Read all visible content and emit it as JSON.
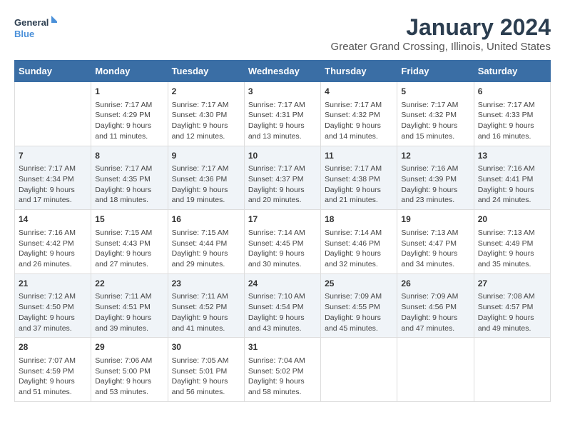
{
  "logo": {
    "line1": "General",
    "line2": "Blue"
  },
  "title": "January 2024",
  "subtitle": "Greater Grand Crossing, Illinois, United States",
  "days_of_week": [
    "Sunday",
    "Monday",
    "Tuesday",
    "Wednesday",
    "Thursday",
    "Friday",
    "Saturday"
  ],
  "weeks": [
    [
      {
        "day": "",
        "content": ""
      },
      {
        "day": "1",
        "content": "Sunrise: 7:17 AM\nSunset: 4:29 PM\nDaylight: 9 hours\nand 11 minutes."
      },
      {
        "day": "2",
        "content": "Sunrise: 7:17 AM\nSunset: 4:30 PM\nDaylight: 9 hours\nand 12 minutes."
      },
      {
        "day": "3",
        "content": "Sunrise: 7:17 AM\nSunset: 4:31 PM\nDaylight: 9 hours\nand 13 minutes."
      },
      {
        "day": "4",
        "content": "Sunrise: 7:17 AM\nSunset: 4:32 PM\nDaylight: 9 hours\nand 14 minutes."
      },
      {
        "day": "5",
        "content": "Sunrise: 7:17 AM\nSunset: 4:32 PM\nDaylight: 9 hours\nand 15 minutes."
      },
      {
        "day": "6",
        "content": "Sunrise: 7:17 AM\nSunset: 4:33 PM\nDaylight: 9 hours\nand 16 minutes."
      }
    ],
    [
      {
        "day": "7",
        "content": "Sunrise: 7:17 AM\nSunset: 4:34 PM\nDaylight: 9 hours\nand 17 minutes."
      },
      {
        "day": "8",
        "content": "Sunrise: 7:17 AM\nSunset: 4:35 PM\nDaylight: 9 hours\nand 18 minutes."
      },
      {
        "day": "9",
        "content": "Sunrise: 7:17 AM\nSunset: 4:36 PM\nDaylight: 9 hours\nand 19 minutes."
      },
      {
        "day": "10",
        "content": "Sunrise: 7:17 AM\nSunset: 4:37 PM\nDaylight: 9 hours\nand 20 minutes."
      },
      {
        "day": "11",
        "content": "Sunrise: 7:17 AM\nSunset: 4:38 PM\nDaylight: 9 hours\nand 21 minutes."
      },
      {
        "day": "12",
        "content": "Sunrise: 7:16 AM\nSunset: 4:39 PM\nDaylight: 9 hours\nand 23 minutes."
      },
      {
        "day": "13",
        "content": "Sunrise: 7:16 AM\nSunset: 4:41 PM\nDaylight: 9 hours\nand 24 minutes."
      }
    ],
    [
      {
        "day": "14",
        "content": "Sunrise: 7:16 AM\nSunset: 4:42 PM\nDaylight: 9 hours\nand 26 minutes."
      },
      {
        "day": "15",
        "content": "Sunrise: 7:15 AM\nSunset: 4:43 PM\nDaylight: 9 hours\nand 27 minutes."
      },
      {
        "day": "16",
        "content": "Sunrise: 7:15 AM\nSunset: 4:44 PM\nDaylight: 9 hours\nand 29 minutes."
      },
      {
        "day": "17",
        "content": "Sunrise: 7:14 AM\nSunset: 4:45 PM\nDaylight: 9 hours\nand 30 minutes."
      },
      {
        "day": "18",
        "content": "Sunrise: 7:14 AM\nSunset: 4:46 PM\nDaylight: 9 hours\nand 32 minutes."
      },
      {
        "day": "19",
        "content": "Sunrise: 7:13 AM\nSunset: 4:47 PM\nDaylight: 9 hours\nand 34 minutes."
      },
      {
        "day": "20",
        "content": "Sunrise: 7:13 AM\nSunset: 4:49 PM\nDaylight: 9 hours\nand 35 minutes."
      }
    ],
    [
      {
        "day": "21",
        "content": "Sunrise: 7:12 AM\nSunset: 4:50 PM\nDaylight: 9 hours\nand 37 minutes."
      },
      {
        "day": "22",
        "content": "Sunrise: 7:11 AM\nSunset: 4:51 PM\nDaylight: 9 hours\nand 39 minutes."
      },
      {
        "day": "23",
        "content": "Sunrise: 7:11 AM\nSunset: 4:52 PM\nDaylight: 9 hours\nand 41 minutes."
      },
      {
        "day": "24",
        "content": "Sunrise: 7:10 AM\nSunset: 4:54 PM\nDaylight: 9 hours\nand 43 minutes."
      },
      {
        "day": "25",
        "content": "Sunrise: 7:09 AM\nSunset: 4:55 PM\nDaylight: 9 hours\nand 45 minutes."
      },
      {
        "day": "26",
        "content": "Sunrise: 7:09 AM\nSunset: 4:56 PM\nDaylight: 9 hours\nand 47 minutes."
      },
      {
        "day": "27",
        "content": "Sunrise: 7:08 AM\nSunset: 4:57 PM\nDaylight: 9 hours\nand 49 minutes."
      }
    ],
    [
      {
        "day": "28",
        "content": "Sunrise: 7:07 AM\nSunset: 4:59 PM\nDaylight: 9 hours\nand 51 minutes."
      },
      {
        "day": "29",
        "content": "Sunrise: 7:06 AM\nSunset: 5:00 PM\nDaylight: 9 hours\nand 53 minutes."
      },
      {
        "day": "30",
        "content": "Sunrise: 7:05 AM\nSunset: 5:01 PM\nDaylight: 9 hours\nand 56 minutes."
      },
      {
        "day": "31",
        "content": "Sunrise: 7:04 AM\nSunset: 5:02 PM\nDaylight: 9 hours\nand 58 minutes."
      },
      {
        "day": "",
        "content": ""
      },
      {
        "day": "",
        "content": ""
      },
      {
        "day": "",
        "content": ""
      }
    ]
  ]
}
